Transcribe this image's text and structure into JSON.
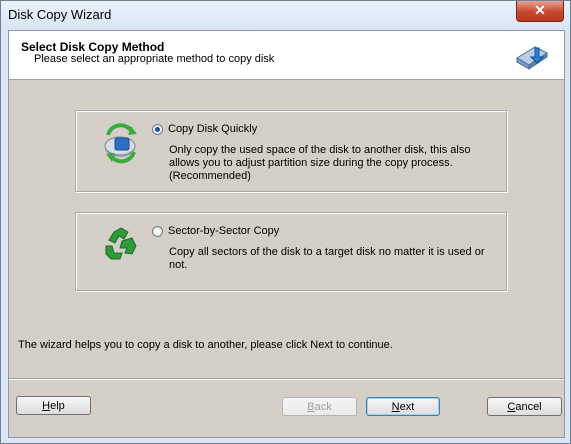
{
  "window": {
    "title": "Disk Copy Wizard",
    "close_glyph": "✕"
  },
  "header": {
    "title": "Select Disk Copy Method",
    "subtitle": "Please select an appropriate method to copy disk",
    "icon": "disk-copy-icon"
  },
  "options": [
    {
      "label": "Copy Disk Quickly",
      "selected": true,
      "description": "Only copy the used space of the disk to another disk, this also allows you to adjust partition size during the copy process.(Recommended)",
      "icon": "disk-arrows-icon"
    },
    {
      "label": "Sector-by-Sector Copy",
      "selected": false,
      "description": "Copy all sectors of the disk to a target disk no matter it is used or not.",
      "icon": "recycle-icon"
    }
  ],
  "footer_text": "The wizard helps you to copy a disk to another, please click Next to continue.",
  "buttons": {
    "help": "Help",
    "back": "Back",
    "next": "Next",
    "cancel": "Cancel"
  },
  "colors": {
    "accent": "#1f4f98",
    "recycle_green": "#2f9a3a",
    "panel_bg": "#d4d0c8"
  }
}
